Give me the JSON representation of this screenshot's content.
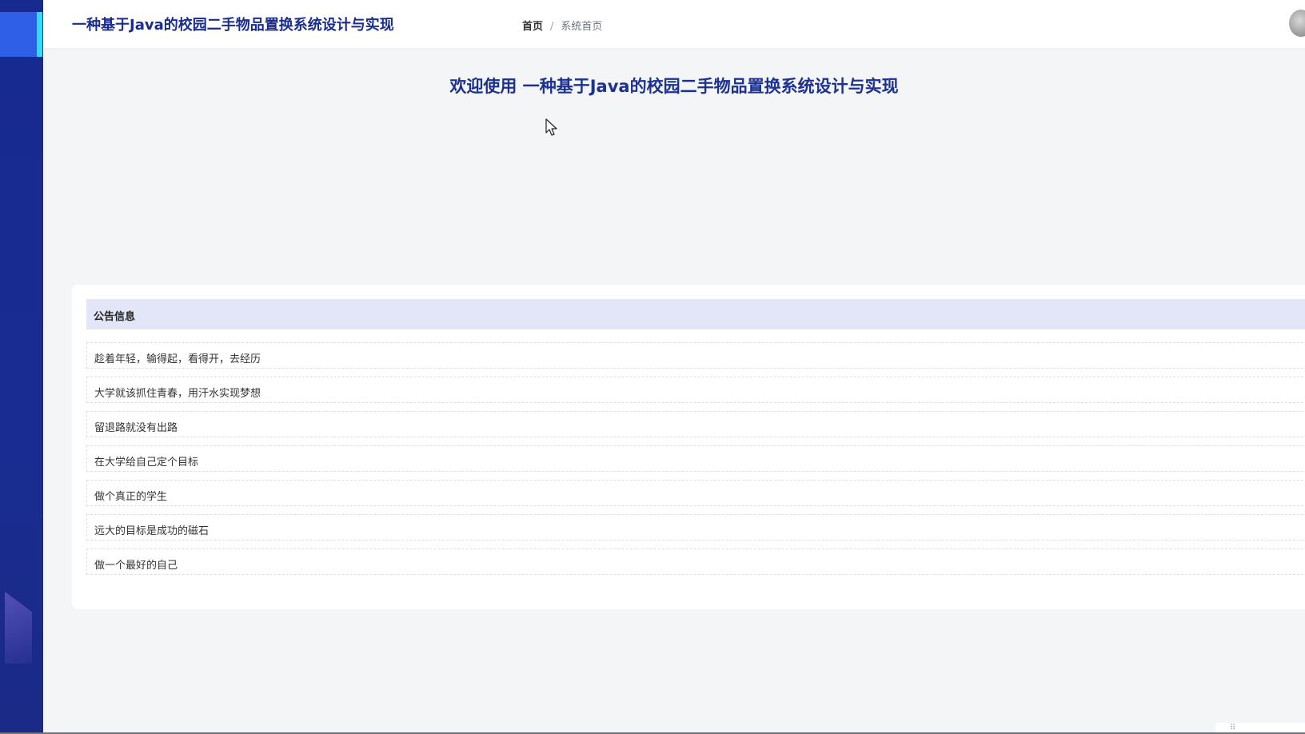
{
  "header": {
    "app_title": "一种基于Java的校园二手物品置换系统设计与实现"
  },
  "breadcrumb": {
    "home": "首页",
    "separator": "/",
    "current": "系统首页"
  },
  "main": {
    "welcome": "欢迎使用 一种基于Java的校园二手物品置换系统设计与实现"
  },
  "notice": {
    "title": "公告信息",
    "items": [
      {
        "label": "趁着年轻，输得起，看得开，去经历"
      },
      {
        "label": "大学就该抓住青春，用汗水实现梦想"
      },
      {
        "label": "留退路就没有出路"
      },
      {
        "label": "在大学给自己定个目标"
      },
      {
        "label": "做个真正的学生"
      },
      {
        "label": "远大的目标是成功的磁石"
      },
      {
        "label": "做一个最好的自己"
      }
    ]
  },
  "colors": {
    "sidebar": "#172a8f",
    "sidebar_active": "#2f5ee7",
    "sidebar_active_bar": "#37d7ff",
    "title_text": "#1a2d8f",
    "notice_header_bg": "#e3e6f6",
    "page_bg": "#f3f5f6"
  },
  "icons": {
    "cursor": "mouse-pointer-icon",
    "avatar": "user-avatar",
    "grip": "grip-dots-icon"
  }
}
